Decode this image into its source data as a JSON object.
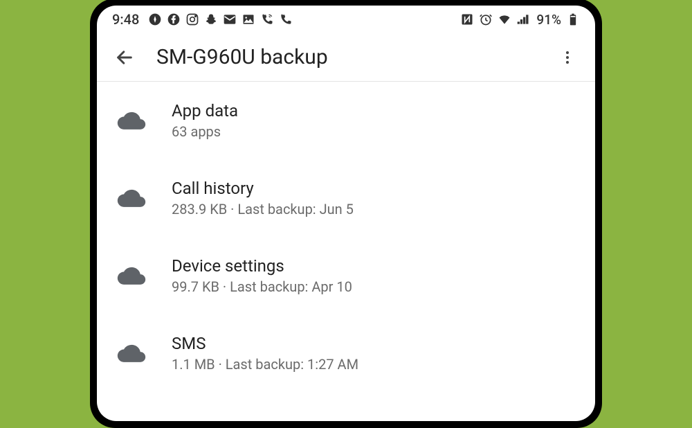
{
  "statusBar": {
    "time": "9:48",
    "batteryPercent": "91%"
  },
  "header": {
    "title": "SM-G960U backup"
  },
  "items": [
    {
      "title": "App data",
      "subtitle": "63 apps"
    },
    {
      "title": "Call history",
      "subtitle": "283.9 KB · Last backup: Jun 5"
    },
    {
      "title": "Device settings",
      "subtitle": "99.7 KB · Last backup: Apr 10"
    },
    {
      "title": "SMS",
      "subtitle": "1.1 MB · Last backup: 1:27 AM"
    }
  ]
}
